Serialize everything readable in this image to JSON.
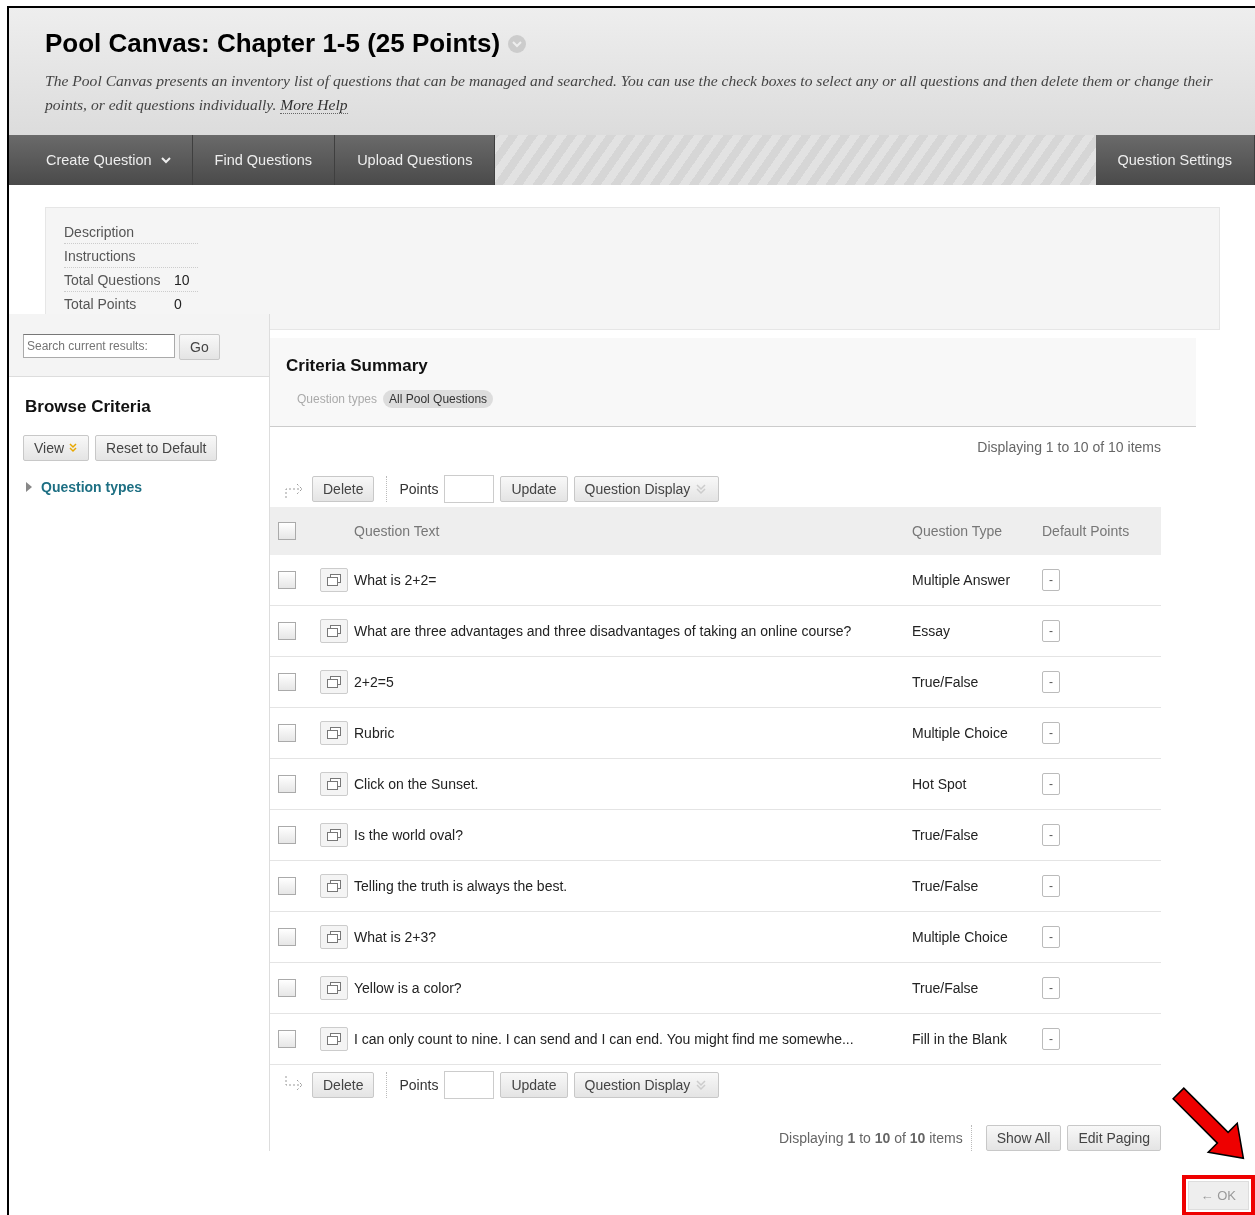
{
  "header": {
    "title": "Pool Canvas: Chapter 1-5 (25 Points)",
    "description": "The Pool Canvas presents an inventory list of questions that can be managed and searched. You can use the check boxes to select any or all questions and then delete them or change their points, or edit questions individually.",
    "help_link": "More Help"
  },
  "action_bar": {
    "menus": [
      {
        "label": "Create Question",
        "kind": "dropdown"
      },
      {
        "label": "Find Questions",
        "kind": "button"
      },
      {
        "label": "Upload Questions",
        "kind": "button"
      }
    ],
    "settings": "Question Settings"
  },
  "details": [
    {
      "label": "Description"
    },
    {
      "label": "Instructions"
    },
    {
      "label": "Total Questions",
      "value": "10"
    },
    {
      "label": "Total Points",
      "value": "0"
    }
  ],
  "sidebar": {
    "search": {
      "placeholder": "Search current results:"
    },
    "go": "Go",
    "title": "Browse Criteria",
    "view": "View",
    "reset": "Reset to Default",
    "criteria": [
      {
        "label": "Question types",
        "expanded": false
      }
    ]
  },
  "criteria_summary": {
    "title": "Criteria Summary",
    "filter_label": "Question types",
    "filter_value": "All Pool Questions"
  },
  "paging_top": "Displaying 1 to 10 of 10 items",
  "toolbars": [
    {
      "delete": "Delete",
      "points_label": "Points",
      "update": "Update",
      "display": "Question Display"
    },
    {
      "delete": "Delete",
      "points_label": "Points",
      "update": "Update",
      "display": "Question Display"
    }
  ],
  "table": {
    "select_all": {
      "checked": false
    },
    "columns": [
      "Question Text",
      "Question Type",
      "Default Points"
    ],
    "rows": [
      {
        "text": "What is 2+2=",
        "type": "Multiple Answer",
        "points": "-",
        "checked": false
      },
      {
        "text": "What are three advantages and three disadvantages of taking an online course?",
        "type": "Essay",
        "points": "-",
        "checked": false
      },
      {
        "text": "2+2=5",
        "type": "True/False",
        "points": "-",
        "checked": false
      },
      {
        "text": "Rubric",
        "type": "Multiple Choice",
        "points": "-",
        "checked": false
      },
      {
        "text": "Click on the Sunset.",
        "type": "Hot Spot",
        "points": "-",
        "checked": false
      },
      {
        "text": "Is the world oval?",
        "type": "True/False",
        "points": "-",
        "checked": false
      },
      {
        "text": "Telling the truth is always the best.",
        "type": "True/False",
        "points": "-",
        "checked": false
      },
      {
        "text": "What is 2+3?",
        "type": "Multiple Choice",
        "points": "-",
        "checked": false
      },
      {
        "text": "Yellow is a color?",
        "type": "True/False",
        "points": "-",
        "checked": false
      },
      {
        "text": "I can only count to nine. I can send and I can end. You might find me somewhe...",
        "type": "Fill in the Blank",
        "points": "-",
        "checked": false
      }
    ]
  },
  "paging_bottom": {
    "text": "Displaying **1** to **10** of **10** items",
    "show_all": "Show All",
    "edit_paging": "Edit Paging"
  },
  "ok_button": "← OK"
}
